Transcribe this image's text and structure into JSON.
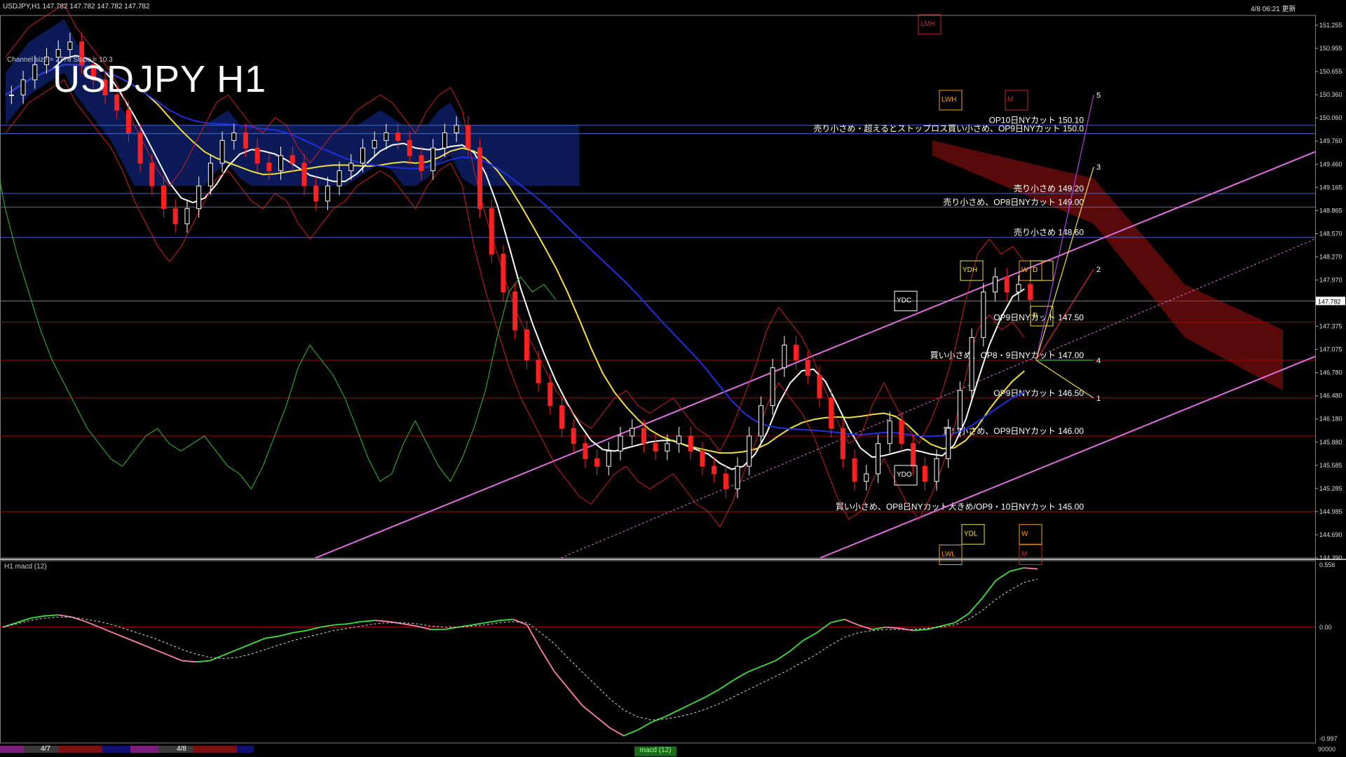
{
  "header": {
    "symbol_info": "USDJPY,H1  147.782 147.782 147.782 147.782",
    "updated": "4/8 06:21 更新",
    "title": "USDJPY H1",
    "channel_info": "Channel size = 2776 Slope = 10.3"
  },
  "colors": {
    "bull": "#ffffff",
    "bear": "#ff2020",
    "price_line": "#808080",
    "hline_red": "#b00000",
    "hline_blue": "#3a6bd4",
    "channel": "#e070e0",
    "sma_white": "#ffffff",
    "sma_yellow": "#f0e040",
    "sma_blue": "#2030e0",
    "bollinger": "#cc2020",
    "chikou": "#30c030",
    "cloud_blue": "#1530a0",
    "cloud_red": "#a01010",
    "macd_green": "#40e040",
    "macd_pink": "#ff80b0"
  },
  "chart_data": {
    "type": "candlestick",
    "symbol": "USDJPY",
    "timeframe": "H1",
    "ylim": [
      144.39,
      151.55
    ],
    "y_ticks": [
      "151.255",
      "150.955",
      "150.655",
      "150.360",
      "150.060",
      "149.760",
      "149.460",
      "149.165",
      "148.865",
      "148.570",
      "148.270",
      "147.970",
      "147.675",
      "147.375",
      "147.075",
      "146.780",
      "146.480",
      "146.180",
      "145.880",
      "145.585",
      "145.285",
      "144.985",
      "144.690",
      "144.390"
    ],
    "current_price": "147.782",
    "close_path": [
      150.5,
      150.7,
      150.9,
      151.0,
      151.1,
      151.2,
      150.9,
      150.7,
      150.5,
      150.3,
      150.0,
      149.6,
      149.3,
      149.0,
      148.8,
      149.0,
      149.3,
      149.6,
      149.9,
      150.0,
      149.8,
      149.6,
      149.5,
      149.7,
      149.6,
      149.3,
      149.1,
      149.3,
      149.5,
      149.6,
      149.8,
      149.9,
      150.0,
      149.9,
      149.7,
      149.5,
      149.8,
      150.0,
      150.1,
      149.8,
      149.0,
      148.4,
      147.9,
      147.4,
      147.0,
      146.7,
      146.4,
      146.1,
      145.9,
      145.7,
      145.6,
      145.8,
      146.0,
      146.1,
      145.9,
      145.8,
      145.9,
      146.0,
      145.8,
      145.6,
      145.5,
      145.3,
      145.6,
      146.0,
      146.4,
      146.9,
      147.2,
      147.0,
      146.8,
      146.5,
      146.1,
      145.7,
      145.4,
      145.5,
      145.9,
      146.2,
      145.9,
      145.6,
      145.4,
      145.7,
      146.1,
      146.6,
      147.3,
      147.9,
      148.1,
      147.9,
      148.0,
      147.8
    ],
    "levels": [
      {
        "text": "OP10日NYカット 150.10",
        "price": 150.1,
        "color": "blue"
      },
      {
        "text": "売り小さめ・超えるとストップロス買い小さめ、OP9日NYカット 150.0",
        "price": 149.99,
        "color": "blue"
      },
      {
        "text": "売り小さめ 149.20",
        "price": 149.2,
        "color": "blue"
      },
      {
        "text": "売り小さめ、OP8日NYカット 149.00",
        "price": 149.02,
        "color": "blue"
      },
      {
        "text": "売り小さめ 148.60",
        "price": 148.62,
        "color": "blue"
      },
      {
        "text": "OP9日NYカット 147.50",
        "price": 147.5,
        "color": "red"
      },
      {
        "text": "買い小さめ、OP8・9日NYカット 147.00",
        "price": 147.0,
        "color": "red"
      },
      {
        "text": "OP9日NYカット 146.50",
        "price": 146.5,
        "color": "red"
      },
      {
        "text": "買い小さめ、OP9日NYカット 146.00",
        "price": 146.0,
        "color": "red"
      },
      {
        "text": "買い小さめ、OP8日NYカット大きめ/OP9・10日NYカット 145.00",
        "price": 145.0,
        "color": "red"
      }
    ],
    "box_labels": [
      {
        "text": "LMH",
        "price": 151.45,
        "color": "#c03030"
      },
      {
        "text": "LWH",
        "price": 150.45,
        "color": "#f0a020"
      },
      {
        "text": "M",
        "price": 150.45,
        "color": "#c03030"
      },
      {
        "text": "YDH",
        "price": 148.2,
        "color": "#f0e040"
      },
      {
        "text": "W",
        "price": 148.2,
        "color": "#f0a020"
      },
      {
        "text": "D",
        "price": 148.2,
        "color": "#f0e040"
      },
      {
        "text": "YDC",
        "price": 147.8,
        "color": "#ffffff"
      },
      {
        "text": "D",
        "price": 147.6,
        "color": "#f0e040"
      },
      {
        "text": "YDO",
        "price": 145.5,
        "color": "#ffffff"
      },
      {
        "text": "YDL",
        "price": 144.72,
        "color": "#f0e040"
      },
      {
        "text": "W",
        "price": 144.72,
        "color": "#f0a020"
      },
      {
        "text": "M",
        "price": 144.45,
        "color": "#c03030"
      },
      {
        "text": "LWL",
        "price": 144.45,
        "color": "#f0a020"
      }
    ],
    "wave_labels": [
      "5",
      "3",
      "2",
      "4",
      "1"
    ],
    "macd": {
      "title": "H1  macd (12)",
      "ylim": [
        -0.997,
        0.556
      ],
      "y_ticks": [
        "0.556",
        "0.00",
        "-0.997"
      ],
      "main": [
        0.0,
        0.04,
        0.08,
        0.1,
        0.11,
        0.09,
        0.05,
        0.0,
        -0.05,
        -0.1,
        -0.15,
        -0.2,
        -0.25,
        -0.3,
        -0.31,
        -0.3,
        -0.25,
        -0.2,
        -0.15,
        -0.1,
        -0.08,
        -0.05,
        -0.03,
        0.0,
        0.02,
        0.03,
        0.05,
        0.06,
        0.05,
        0.03,
        0.01,
        -0.02,
        -0.02,
        0.0,
        0.02,
        0.04,
        0.06,
        0.07,
        0.02,
        -0.2,
        -0.4,
        -0.55,
        -0.7,
        -0.8,
        -0.9,
        -0.97,
        -0.92,
        -0.85,
        -0.8,
        -0.74,
        -0.68,
        -0.62,
        -0.55,
        -0.47,
        -0.4,
        -0.35,
        -0.3,
        -0.22,
        -0.12,
        -0.05,
        0.04,
        0.07,
        0.02,
        -0.02,
        0.0,
        -0.01,
        -0.03,
        -0.02,
        0.01,
        0.04,
        0.12,
        0.26,
        0.42,
        0.5,
        0.53,
        0.52
      ],
      "signal": [
        0.0,
        0.03,
        0.06,
        0.08,
        0.09,
        0.09,
        0.07,
        0.05,
        0.02,
        -0.02,
        -0.06,
        -0.1,
        -0.15,
        -0.2,
        -0.24,
        -0.27,
        -0.28,
        -0.27,
        -0.24,
        -0.2,
        -0.16,
        -0.12,
        -0.09,
        -0.06,
        -0.03,
        -0.01,
        0.01,
        0.03,
        0.04,
        0.04,
        0.03,
        0.01,
        0.0,
        0.0,
        0.01,
        0.02,
        0.04,
        0.05,
        0.04,
        -0.05,
        -0.15,
        -0.28,
        -0.4,
        -0.52,
        -0.64,
        -0.74,
        -0.8,
        -0.83,
        -0.82,
        -0.8,
        -0.77,
        -0.73,
        -0.68,
        -0.62,
        -0.56,
        -0.5,
        -0.44,
        -0.38,
        -0.31,
        -0.24,
        -0.16,
        -0.09,
        -0.05,
        -0.03,
        -0.02,
        -0.02,
        -0.02,
        -0.01,
        0.0,
        0.02,
        0.07,
        0.15,
        0.25,
        0.33,
        0.4,
        0.43
      ]
    }
  },
  "footer": {
    "date1": "4/7",
    "date2": "4/8",
    "macd_tab": "macd (12)",
    "vol_value": "90000"
  }
}
